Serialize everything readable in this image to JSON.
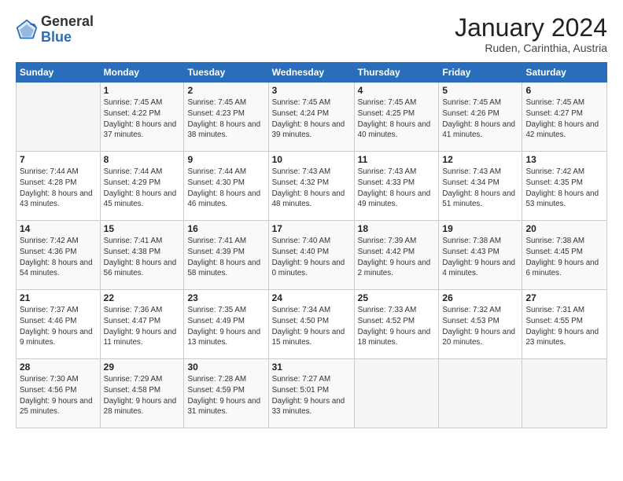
{
  "header": {
    "logo_general": "General",
    "logo_blue": "Blue",
    "month_title": "January 2024",
    "subtitle": "Ruden, Carinthia, Austria"
  },
  "weekdays": [
    "Sunday",
    "Monday",
    "Tuesday",
    "Wednesday",
    "Thursday",
    "Friday",
    "Saturday"
  ],
  "weeks": [
    [
      {
        "day": "",
        "sunrise": "",
        "sunset": "",
        "daylight": ""
      },
      {
        "day": "1",
        "sunrise": "Sunrise: 7:45 AM",
        "sunset": "Sunset: 4:22 PM",
        "daylight": "Daylight: 8 hours and 37 minutes."
      },
      {
        "day": "2",
        "sunrise": "Sunrise: 7:45 AM",
        "sunset": "Sunset: 4:23 PM",
        "daylight": "Daylight: 8 hours and 38 minutes."
      },
      {
        "day": "3",
        "sunrise": "Sunrise: 7:45 AM",
        "sunset": "Sunset: 4:24 PM",
        "daylight": "Daylight: 8 hours and 39 minutes."
      },
      {
        "day": "4",
        "sunrise": "Sunrise: 7:45 AM",
        "sunset": "Sunset: 4:25 PM",
        "daylight": "Daylight: 8 hours and 40 minutes."
      },
      {
        "day": "5",
        "sunrise": "Sunrise: 7:45 AM",
        "sunset": "Sunset: 4:26 PM",
        "daylight": "Daylight: 8 hours and 41 minutes."
      },
      {
        "day": "6",
        "sunrise": "Sunrise: 7:45 AM",
        "sunset": "Sunset: 4:27 PM",
        "daylight": "Daylight: 8 hours and 42 minutes."
      }
    ],
    [
      {
        "day": "7",
        "sunrise": "Sunrise: 7:44 AM",
        "sunset": "Sunset: 4:28 PM",
        "daylight": "Daylight: 8 hours and 43 minutes."
      },
      {
        "day": "8",
        "sunrise": "Sunrise: 7:44 AM",
        "sunset": "Sunset: 4:29 PM",
        "daylight": "Daylight: 8 hours and 45 minutes."
      },
      {
        "day": "9",
        "sunrise": "Sunrise: 7:44 AM",
        "sunset": "Sunset: 4:30 PM",
        "daylight": "Daylight: 8 hours and 46 minutes."
      },
      {
        "day": "10",
        "sunrise": "Sunrise: 7:43 AM",
        "sunset": "Sunset: 4:32 PM",
        "daylight": "Daylight: 8 hours and 48 minutes."
      },
      {
        "day": "11",
        "sunrise": "Sunrise: 7:43 AM",
        "sunset": "Sunset: 4:33 PM",
        "daylight": "Daylight: 8 hours and 49 minutes."
      },
      {
        "day": "12",
        "sunrise": "Sunrise: 7:43 AM",
        "sunset": "Sunset: 4:34 PM",
        "daylight": "Daylight: 8 hours and 51 minutes."
      },
      {
        "day": "13",
        "sunrise": "Sunrise: 7:42 AM",
        "sunset": "Sunset: 4:35 PM",
        "daylight": "Daylight: 8 hours and 53 minutes."
      }
    ],
    [
      {
        "day": "14",
        "sunrise": "Sunrise: 7:42 AM",
        "sunset": "Sunset: 4:36 PM",
        "daylight": "Daylight: 8 hours and 54 minutes."
      },
      {
        "day": "15",
        "sunrise": "Sunrise: 7:41 AM",
        "sunset": "Sunset: 4:38 PM",
        "daylight": "Daylight: 8 hours and 56 minutes."
      },
      {
        "day": "16",
        "sunrise": "Sunrise: 7:41 AM",
        "sunset": "Sunset: 4:39 PM",
        "daylight": "Daylight: 8 hours and 58 minutes."
      },
      {
        "day": "17",
        "sunrise": "Sunrise: 7:40 AM",
        "sunset": "Sunset: 4:40 PM",
        "daylight": "Daylight: 9 hours and 0 minutes."
      },
      {
        "day": "18",
        "sunrise": "Sunrise: 7:39 AM",
        "sunset": "Sunset: 4:42 PM",
        "daylight": "Daylight: 9 hours and 2 minutes."
      },
      {
        "day": "19",
        "sunrise": "Sunrise: 7:38 AM",
        "sunset": "Sunset: 4:43 PM",
        "daylight": "Daylight: 9 hours and 4 minutes."
      },
      {
        "day": "20",
        "sunrise": "Sunrise: 7:38 AM",
        "sunset": "Sunset: 4:45 PM",
        "daylight": "Daylight: 9 hours and 6 minutes."
      }
    ],
    [
      {
        "day": "21",
        "sunrise": "Sunrise: 7:37 AM",
        "sunset": "Sunset: 4:46 PM",
        "daylight": "Daylight: 9 hours and 9 minutes."
      },
      {
        "day": "22",
        "sunrise": "Sunrise: 7:36 AM",
        "sunset": "Sunset: 4:47 PM",
        "daylight": "Daylight: 9 hours and 11 minutes."
      },
      {
        "day": "23",
        "sunrise": "Sunrise: 7:35 AM",
        "sunset": "Sunset: 4:49 PM",
        "daylight": "Daylight: 9 hours and 13 minutes."
      },
      {
        "day": "24",
        "sunrise": "Sunrise: 7:34 AM",
        "sunset": "Sunset: 4:50 PM",
        "daylight": "Daylight: 9 hours and 15 minutes."
      },
      {
        "day": "25",
        "sunrise": "Sunrise: 7:33 AM",
        "sunset": "Sunset: 4:52 PM",
        "daylight": "Daylight: 9 hours and 18 minutes."
      },
      {
        "day": "26",
        "sunrise": "Sunrise: 7:32 AM",
        "sunset": "Sunset: 4:53 PM",
        "daylight": "Daylight: 9 hours and 20 minutes."
      },
      {
        "day": "27",
        "sunrise": "Sunrise: 7:31 AM",
        "sunset": "Sunset: 4:55 PM",
        "daylight": "Daylight: 9 hours and 23 minutes."
      }
    ],
    [
      {
        "day": "28",
        "sunrise": "Sunrise: 7:30 AM",
        "sunset": "Sunset: 4:56 PM",
        "daylight": "Daylight: 9 hours and 25 minutes."
      },
      {
        "day": "29",
        "sunrise": "Sunrise: 7:29 AM",
        "sunset": "Sunset: 4:58 PM",
        "daylight": "Daylight: 9 hours and 28 minutes."
      },
      {
        "day": "30",
        "sunrise": "Sunrise: 7:28 AM",
        "sunset": "Sunset: 4:59 PM",
        "daylight": "Daylight: 9 hours and 31 minutes."
      },
      {
        "day": "31",
        "sunrise": "Sunrise: 7:27 AM",
        "sunset": "Sunset: 5:01 PM",
        "daylight": "Daylight: 9 hours and 33 minutes."
      },
      {
        "day": "",
        "sunrise": "",
        "sunset": "",
        "daylight": ""
      },
      {
        "day": "",
        "sunrise": "",
        "sunset": "",
        "daylight": ""
      },
      {
        "day": "",
        "sunrise": "",
        "sunset": "",
        "daylight": ""
      }
    ]
  ]
}
